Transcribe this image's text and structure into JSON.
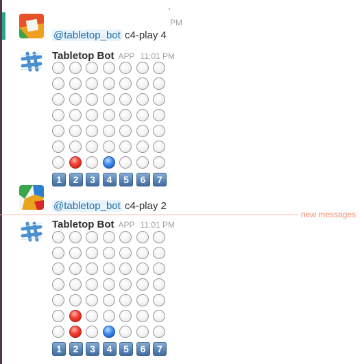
{
  "messages": {
    "first_post": {
      "mention": "@tabletop_bot",
      "command": "c4-play 4",
      "time": "PM"
    },
    "bot_reply_1": {
      "sender": "Tabletop Bot",
      "badge": "APP",
      "time": "11:01 PM"
    },
    "second_post": {
      "mention": "@tabletop_bot",
      "command": "c4-play 2"
    },
    "new_messages_label": "new messages",
    "bot_reply_2": {
      "sender": "Tabletop Bot",
      "badge": "APP",
      "time": "11:01 PM"
    }
  },
  "boards": [
    {
      "rows": [
        [
          "e",
          "e",
          "e",
          "e",
          "e",
          "e",
          "e"
        ],
        [
          "e",
          "e",
          "e",
          "e",
          "e",
          "e",
          "e"
        ],
        [
          "e",
          "e",
          "e",
          "e",
          "e",
          "e",
          "e"
        ],
        [
          "e",
          "e",
          "e",
          "e",
          "e",
          "e",
          "e"
        ],
        [
          "e",
          "e",
          "e",
          "e",
          "e",
          "e",
          "e"
        ],
        [
          "e",
          "e",
          "e",
          "e",
          "e",
          "e",
          "e"
        ],
        [
          "e",
          "r",
          "e",
          "b",
          "e",
          "e",
          "e"
        ]
      ],
      "columns": [
        "1",
        "2",
        "3",
        "4",
        "5",
        "6",
        "7"
      ]
    },
    {
      "rows": [
        [
          "e",
          "e",
          "e",
          "e",
          "e",
          "e",
          "e"
        ],
        [
          "e",
          "e",
          "e",
          "e",
          "e",
          "e",
          "e"
        ],
        [
          "e",
          "e",
          "e",
          "e",
          "e",
          "e",
          "e"
        ],
        [
          "e",
          "e",
          "e",
          "e",
          "e",
          "e",
          "e"
        ],
        [
          "e",
          "e",
          "e",
          "e",
          "e",
          "e",
          "e"
        ],
        [
          "e",
          "r",
          "e",
          "e",
          "e",
          "e",
          "e"
        ],
        [
          "e",
          "r",
          "e",
          "b",
          "e",
          "e",
          "e"
        ]
      ],
      "columns": [
        "1",
        "2",
        "3",
        "4",
        "5",
        "6",
        "7"
      ]
    }
  ],
  "colors": {
    "red_piece": "#f23c2c",
    "blue_piece": "#3a8ef0",
    "mention_text": "#1d6ea8",
    "new_messages": "#f28b6b"
  }
}
